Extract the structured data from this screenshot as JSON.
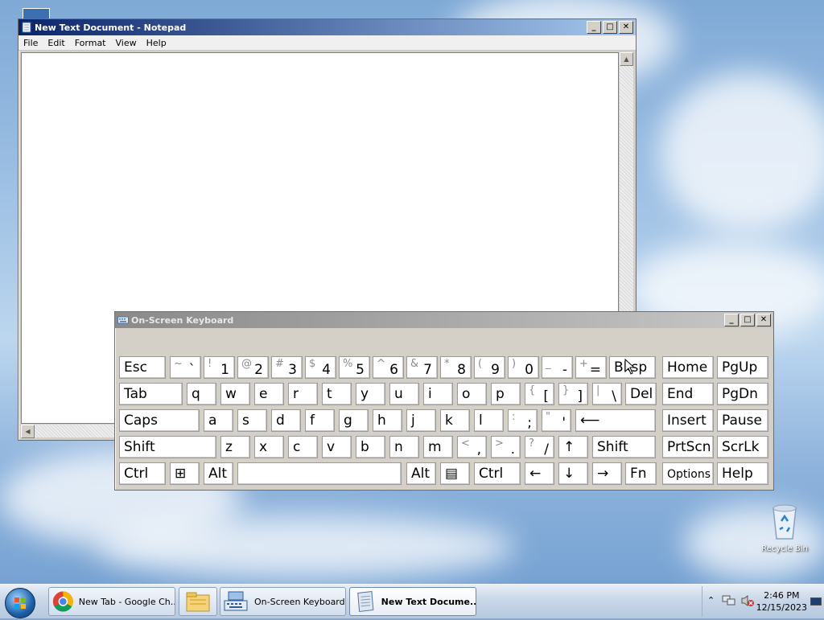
{
  "desktop": {
    "recycle_bin_label": "Recycle Bin"
  },
  "notepad": {
    "title": "New Text Document - Notepad",
    "menu": [
      "File",
      "Edit",
      "Format",
      "View",
      "Help"
    ],
    "content": ""
  },
  "osk": {
    "title": "On-Screen Keyboard",
    "rows": [
      [
        {
          "name": "esc",
          "main": "Esc"
        },
        {
          "name": "backtick",
          "sm": "~",
          "lg": "`"
        },
        {
          "name": "1",
          "sm": "!",
          "lg": "1"
        },
        {
          "name": "2",
          "sm": "@",
          "lg": "2"
        },
        {
          "name": "3",
          "sm": "#",
          "lg": "3"
        },
        {
          "name": "4",
          "sm": "$",
          "lg": "4"
        },
        {
          "name": "5",
          "sm": "%",
          "lg": "5"
        },
        {
          "name": "6",
          "sm": "^",
          "lg": "6"
        },
        {
          "name": "7",
          "sm": "&",
          "lg": "7"
        },
        {
          "name": "8",
          "sm": "*",
          "lg": "8"
        },
        {
          "name": "9",
          "sm": "(",
          "lg": "9"
        },
        {
          "name": "0",
          "sm": ")",
          "lg": "0"
        },
        {
          "name": "minus",
          "sm": "_",
          "lg": "-"
        },
        {
          "name": "equals",
          "sm": "+",
          "lg": "="
        },
        {
          "name": "backspace",
          "main": "Bksp"
        },
        {
          "name": "home",
          "main": "Home"
        },
        {
          "name": "pgup",
          "main": "PgUp"
        }
      ],
      [
        {
          "name": "tab",
          "main": "Tab"
        },
        {
          "name": "q",
          "main": "q"
        },
        {
          "name": "w",
          "main": "w"
        },
        {
          "name": "e",
          "main": "e"
        },
        {
          "name": "r",
          "main": "r"
        },
        {
          "name": "t",
          "main": "t"
        },
        {
          "name": "y",
          "main": "y"
        },
        {
          "name": "u",
          "main": "u"
        },
        {
          "name": "i",
          "main": "i"
        },
        {
          "name": "o",
          "main": "o"
        },
        {
          "name": "p",
          "main": "p"
        },
        {
          "name": "lbracket",
          "sm": "{",
          "lg": "["
        },
        {
          "name": "rbracket",
          "sm": "}",
          "lg": "]"
        },
        {
          "name": "backslash",
          "sm": "|",
          "lg": "\\"
        },
        {
          "name": "del",
          "main": "Del"
        },
        {
          "name": "end",
          "main": "End"
        },
        {
          "name": "pgdn",
          "main": "PgDn"
        }
      ],
      [
        {
          "name": "caps",
          "main": "Caps"
        },
        {
          "name": "a",
          "main": "a"
        },
        {
          "name": "s",
          "main": "s"
        },
        {
          "name": "d",
          "main": "d"
        },
        {
          "name": "f",
          "main": "f"
        },
        {
          "name": "g",
          "main": "g"
        },
        {
          "name": "h",
          "main": "h"
        },
        {
          "name": "j",
          "main": "j"
        },
        {
          "name": "k",
          "main": "k"
        },
        {
          "name": "l",
          "main": "l"
        },
        {
          "name": "semicolon",
          "sm": ":",
          "lg": ";"
        },
        {
          "name": "quote",
          "sm": "\"",
          "lg": "'"
        },
        {
          "name": "enter",
          "main": "⟵"
        },
        {
          "name": "insert",
          "main": "Insert"
        },
        {
          "name": "pause",
          "main": "Pause"
        }
      ],
      [
        {
          "name": "lshift",
          "main": "Shift"
        },
        {
          "name": "z",
          "main": "z"
        },
        {
          "name": "x",
          "main": "x"
        },
        {
          "name": "c",
          "main": "c"
        },
        {
          "name": "v",
          "main": "v"
        },
        {
          "name": "b",
          "main": "b"
        },
        {
          "name": "n",
          "main": "n"
        },
        {
          "name": "m",
          "main": "m"
        },
        {
          "name": "comma",
          "sm": "<",
          "lg": ","
        },
        {
          "name": "period",
          "sm": ">",
          "lg": "."
        },
        {
          "name": "slash",
          "sm": "?",
          "lg": "/"
        },
        {
          "name": "up",
          "main": "↑"
        },
        {
          "name": "rshift",
          "main": "Shift"
        },
        {
          "name": "prtscn",
          "main": "PrtScn"
        },
        {
          "name": "scrlk",
          "main": "ScrLk"
        }
      ],
      [
        {
          "name": "lctrl",
          "main": "Ctrl"
        },
        {
          "name": "win",
          "main": "⊞"
        },
        {
          "name": "lalt",
          "main": "Alt"
        },
        {
          "name": "space",
          "main": ""
        },
        {
          "name": "ralt",
          "main": "Alt"
        },
        {
          "name": "menu",
          "main": "▤"
        },
        {
          "name": "rctrl",
          "main": "Ctrl"
        },
        {
          "name": "left",
          "main": "←"
        },
        {
          "name": "down",
          "main": "↓"
        },
        {
          "name": "right",
          "main": "→"
        },
        {
          "name": "fn",
          "main": "Fn"
        },
        {
          "name": "options",
          "main": "Options"
        },
        {
          "name": "help",
          "main": "Help"
        }
      ]
    ]
  },
  "taskbar": {
    "buttons": [
      {
        "label": "New Tab - Google Ch...",
        "icon": "chrome-icon"
      },
      {
        "label": "",
        "icon": "file-explorer-icon"
      },
      {
        "label": "On-Screen Keyboard",
        "icon": "keyboard-icon"
      },
      {
        "label": "New Text Docume...",
        "icon": "notepad-icon",
        "active": true
      }
    ],
    "clock": {
      "time": "2:46 PM",
      "date": "12/15/2023"
    }
  }
}
